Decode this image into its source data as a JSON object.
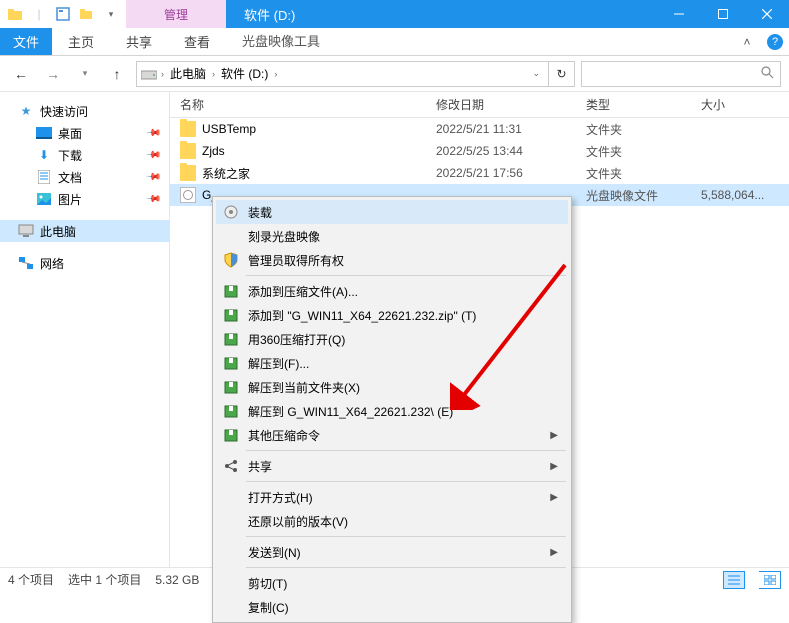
{
  "titlebar": {
    "tool_context": "管理",
    "window_title": "软件 (D:)"
  },
  "ribbon": {
    "file": "文件",
    "tabs": [
      "主页",
      "共享",
      "查看"
    ],
    "tool_tab": "光盘映像工具"
  },
  "nav": {
    "breadcrumb": [
      "此电脑",
      "软件 (D:)"
    ]
  },
  "navpane": {
    "quick_access": "快速访问",
    "desktop": "桌面",
    "downloads": "下载",
    "documents": "文档",
    "pictures": "图片",
    "this_pc": "此电脑",
    "network": "网络"
  },
  "columns": {
    "name": "名称",
    "date": "修改日期",
    "type": "类型",
    "size": "大小"
  },
  "rows": [
    {
      "name": "USBTemp",
      "date": "2022/5/21 11:31",
      "type": "文件夹",
      "size": "",
      "icon": "folder"
    },
    {
      "name": "Zjds",
      "date": "2022/5/25 13:44",
      "type": "文件夹",
      "size": "",
      "icon": "folder"
    },
    {
      "name": "系统之家",
      "date": "2022/5/21 17:56",
      "type": "文件夹",
      "size": "",
      "icon": "folder"
    },
    {
      "name": "G_",
      "date": "",
      "type": "光盘映像文件",
      "size": "5,588,064...",
      "icon": "iso",
      "selected": true
    }
  ],
  "context_menu": {
    "items": [
      {
        "label": "装载",
        "icon": "mount",
        "highlight": true
      },
      {
        "label": "刻录光盘映像",
        "icon": ""
      },
      {
        "label": "管理员取得所有权",
        "icon": "shield"
      },
      {
        "sep": true
      },
      {
        "label": "添加到压缩文件(A)...",
        "icon": "archive"
      },
      {
        "label": "添加到 \"G_WIN11_X64_22621.232.zip\" (T)",
        "icon": "archive"
      },
      {
        "label": "用360压缩打开(Q)",
        "icon": "archive"
      },
      {
        "label": "解压到(F)...",
        "icon": "archive"
      },
      {
        "label": "解压到当前文件夹(X)",
        "icon": "archive"
      },
      {
        "label": "解压到 G_WIN11_X64_22621.232\\ (E)",
        "icon": "archive"
      },
      {
        "label": "其他压缩命令",
        "icon": "archive",
        "submenu": true
      },
      {
        "sep": true
      },
      {
        "label": "共享",
        "icon": "share",
        "submenu": true
      },
      {
        "sep": true
      },
      {
        "label": "打开方式(H)",
        "submenu": true
      },
      {
        "label": "还原以前的版本(V)"
      },
      {
        "sep": true
      },
      {
        "label": "发送到(N)",
        "submenu": true
      },
      {
        "sep": true
      },
      {
        "label": "剪切(T)"
      },
      {
        "label": "复制(C)"
      }
    ]
  },
  "statusbar": {
    "count": "4 个项目",
    "selection": "选中 1 个项目",
    "size": "5.32 GB"
  }
}
